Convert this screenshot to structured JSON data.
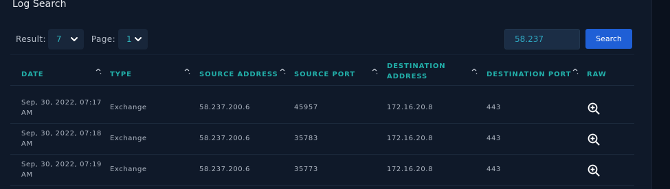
{
  "page": {
    "title": "Log Search"
  },
  "toolbar": {
    "result_label": "Result:",
    "result_value": "7",
    "page_label": "Page:",
    "page_value": "1",
    "search_value": "58.237",
    "search_button": "Search"
  },
  "table": {
    "headers": {
      "date": "DATE",
      "type": "TYPE",
      "source_address": "SOURCE ADDRESS",
      "source_port": "SOURCE PORT",
      "destination_address_line1": "DESTINATION",
      "destination_address_line2": "ADDRESS",
      "destination_port": "DESTINATION PORT",
      "raw": "RAW"
    },
    "rows": [
      {
        "date_line1": "Sep, 30, 2022, 07:17",
        "date_line2": "AM",
        "type": "Exchange",
        "source_address": "58.237.200.6",
        "source_port": "45957",
        "destination_address": "172.16.20.8",
        "destination_port": "443"
      },
      {
        "date_line1": "Sep, 30, 2022, 07:18",
        "date_line2": "AM",
        "type": "Exchange",
        "source_address": "58.237.200.6",
        "source_port": "35783",
        "destination_address": "172.16.20.8",
        "destination_port": "443"
      },
      {
        "date_line1": "Sep, 30, 2022, 07:19",
        "date_line2": "AM",
        "type": "Exchange",
        "source_address": "58.237.200.6",
        "source_port": "35773",
        "destination_address": "172.16.20.8",
        "destination_port": "443"
      }
    ]
  },
  "icons": {
    "sort": "sort-icon",
    "raw": "zoom-in-icon",
    "chevron": "chevron-down-icon"
  },
  "colors": {
    "background": "#0f1929",
    "header_text": "#22b0aa",
    "select_value": "#2fb4bc",
    "search_button": "#1f5fd6",
    "input_background": "#1b2d45"
  }
}
